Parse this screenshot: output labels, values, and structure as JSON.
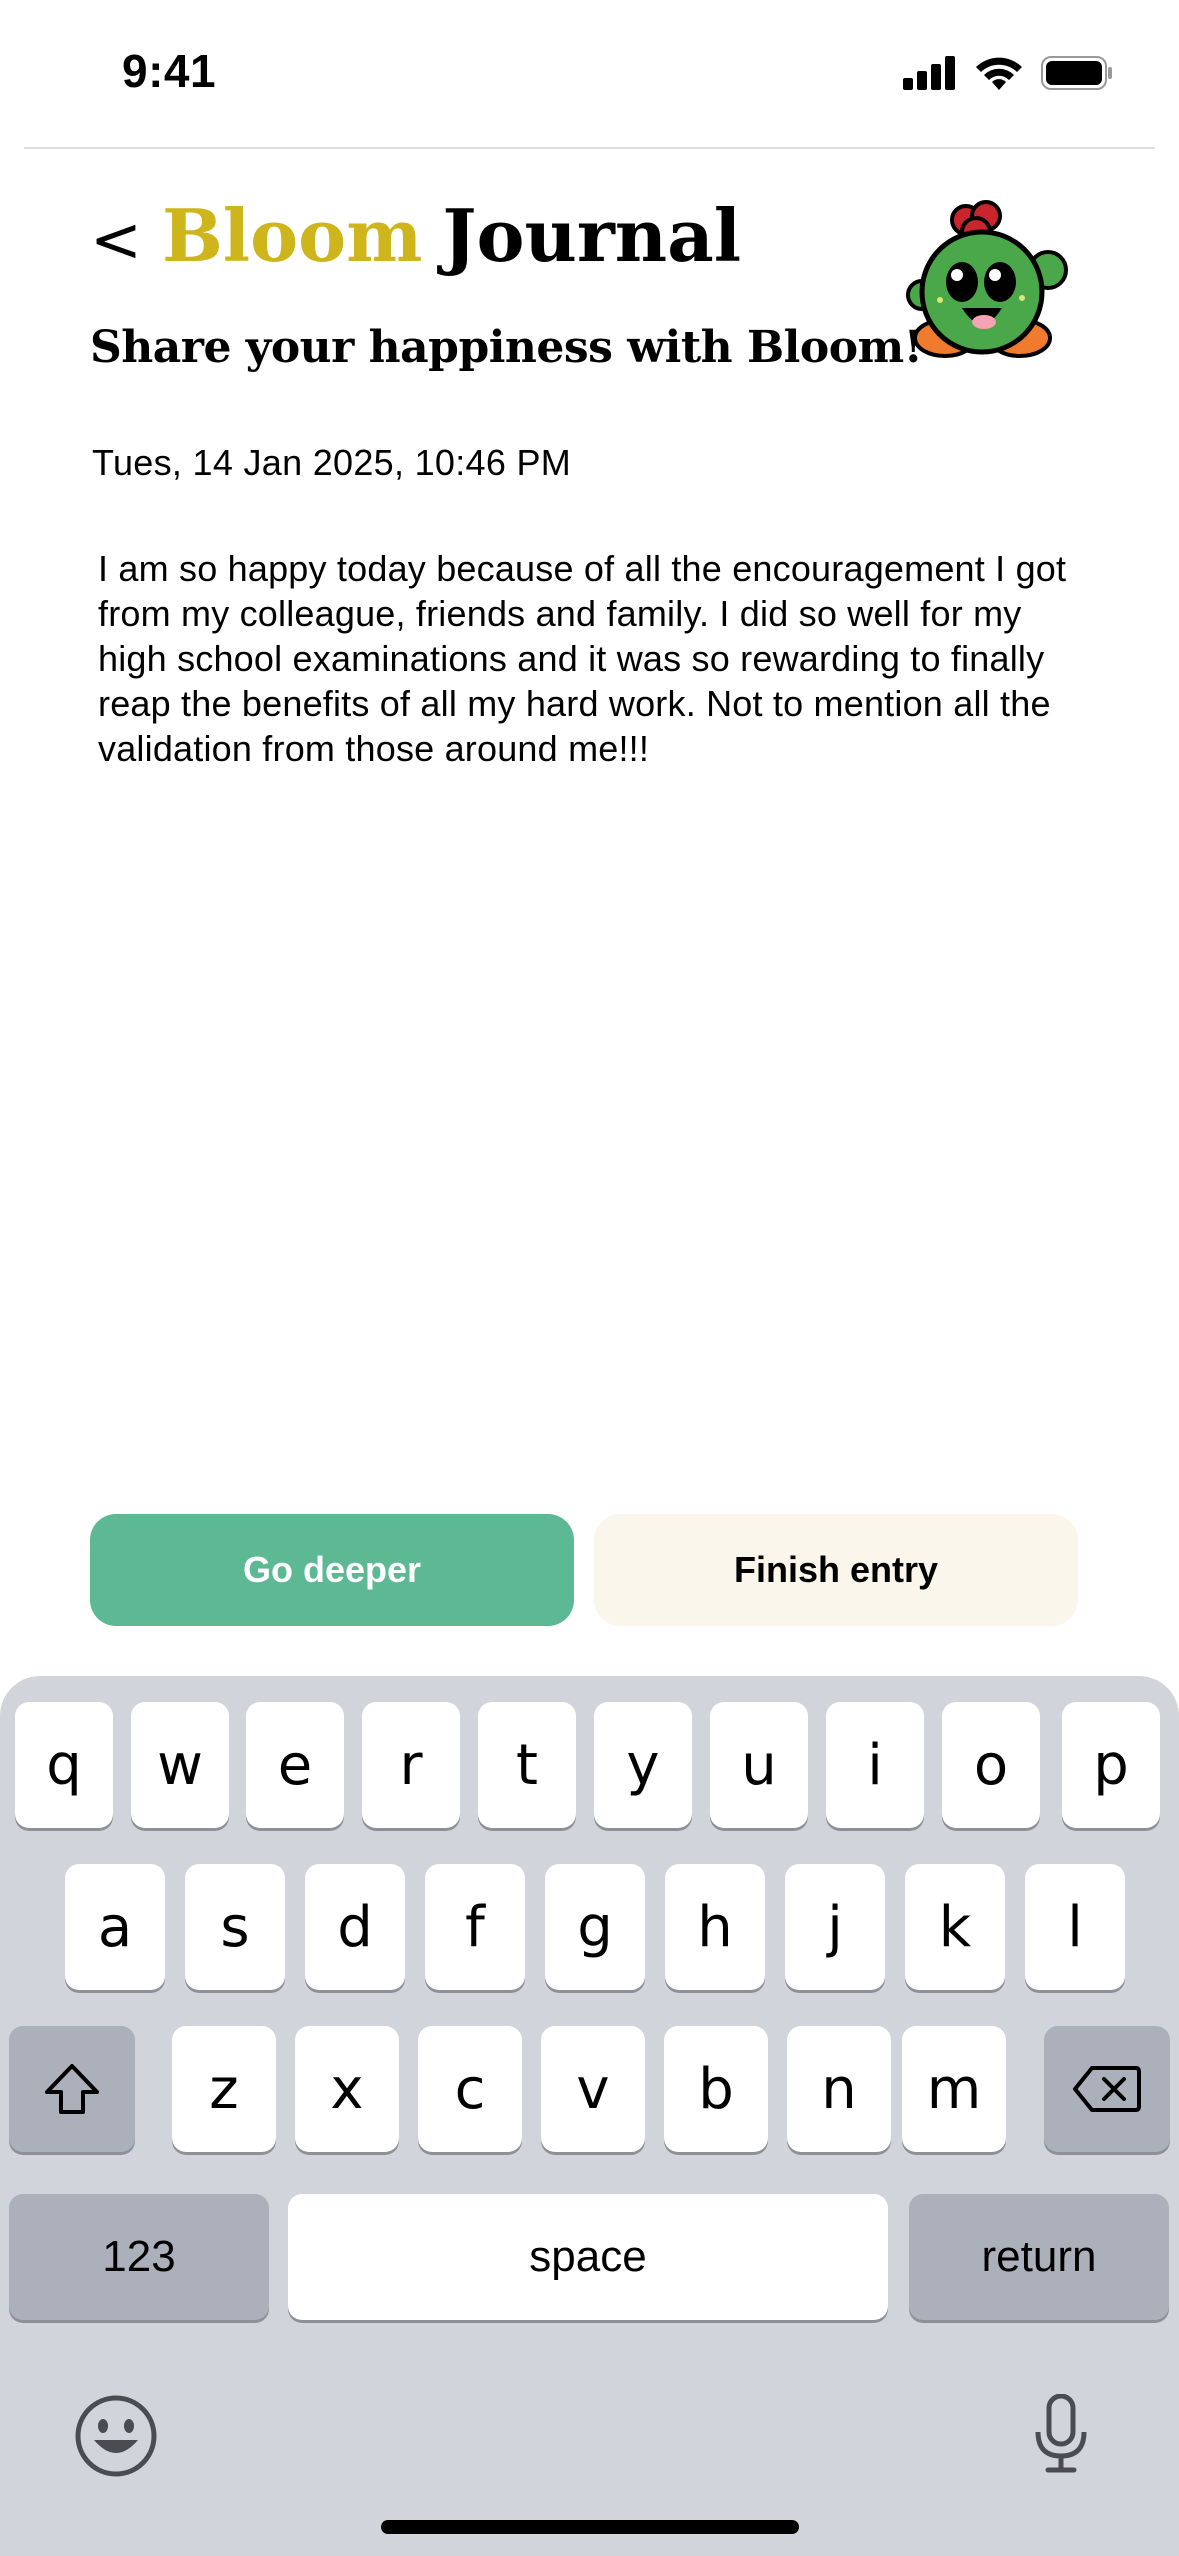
{
  "status_bar": {
    "time": "9:41"
  },
  "header": {
    "back_label": "<",
    "brand_word": "Bloom",
    "title_word": "Journal",
    "subtitle": "Share your happiness with Bloom!"
  },
  "entry": {
    "date": "Tues, 14 Jan 2025, 10:46 PM",
    "text": "I am so happy today because of all the encouragement I got from my colleague, friends and family. I did so well for my high school examinations and it was so rewarding to finally reap the benefits of all my hard work. Not to mention all the validation from those around me!!!"
  },
  "actions": {
    "go_deeper": "Go deeper",
    "finish_entry": "Finish entry"
  },
  "keyboard": {
    "row1": [
      "q",
      "w",
      "e",
      "r",
      "t",
      "y",
      "u",
      "i",
      "o",
      "p"
    ],
    "row2": [
      "a",
      "s",
      "d",
      "f",
      "g",
      "h",
      "j",
      "k",
      "l"
    ],
    "row3": [
      "z",
      "x",
      "c",
      "v",
      "b",
      "n",
      "m"
    ],
    "numbers_label": "123",
    "space_label": "space",
    "return_label": "return"
  },
  "colors": {
    "brand_yellow": "#cdb51b",
    "go_deeper_bg": "#5cb994",
    "finish_bg": "#fbf6ec",
    "keyboard_bg": "#d1d4db"
  },
  "icons": [
    "cellular-signal-icon",
    "wifi-icon",
    "battery-icon",
    "bloom-mascot",
    "shift-icon",
    "delete-icon",
    "emoji-icon",
    "microphone-icon"
  ]
}
